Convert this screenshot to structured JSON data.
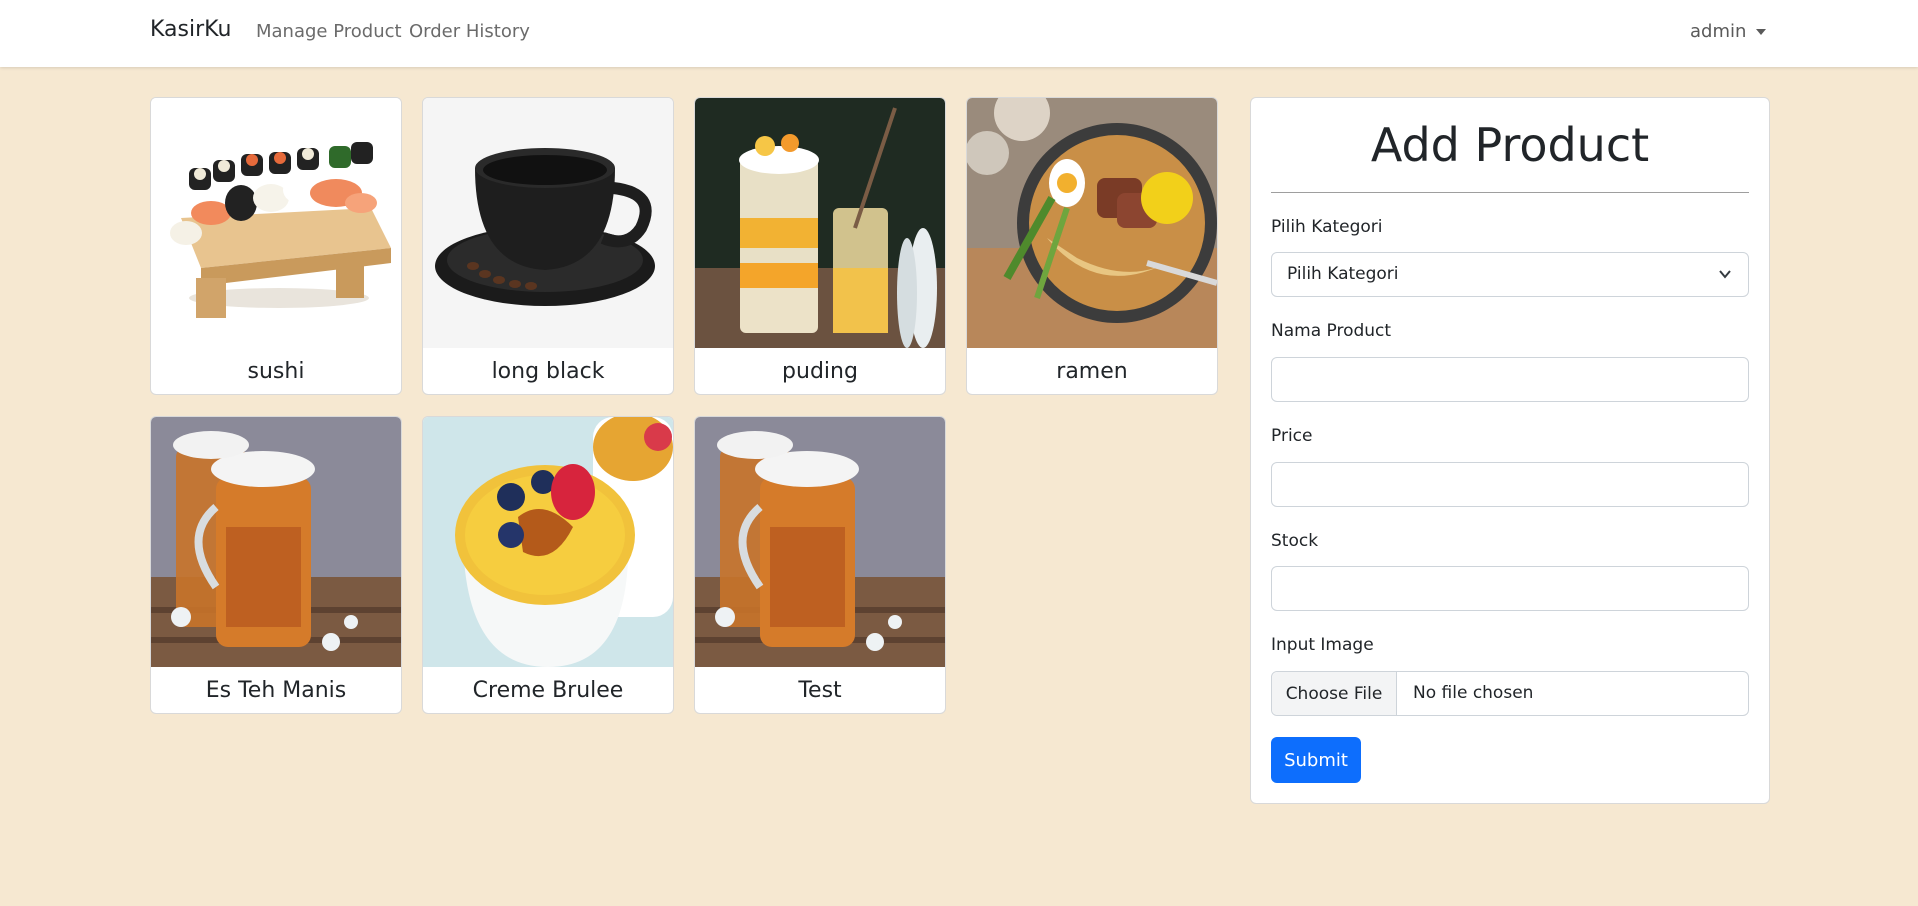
{
  "navbar": {
    "brand": "KasirKu",
    "links": [
      "Manage Product",
      "Order History"
    ],
    "user": "admin"
  },
  "products": [
    {
      "name": "sushi",
      "image": "sushi-platter"
    },
    {
      "name": "long black",
      "image": "coffee-cup"
    },
    {
      "name": "puding",
      "image": "pudding-glass"
    },
    {
      "name": "ramen",
      "image": "ramen-bowl"
    },
    {
      "name": "Es Teh Manis",
      "image": "iced-tea-jar"
    },
    {
      "name": "Creme Brulee",
      "image": "creme-brulee"
    },
    {
      "name": "Test",
      "image": "iced-tea-jar"
    }
  ],
  "form": {
    "title": "Add Product",
    "category_label": "Pilih Kategori",
    "category_selected": "Pilih Kategori",
    "name_label": "Nama Product",
    "price_label": "Price",
    "stock_label": "Stock",
    "image_label": "Input Image",
    "file_button": "Choose File",
    "file_status": "No file chosen",
    "submit": "Submit"
  },
  "colors": {
    "page_bg": "#f6e8d1",
    "primary": "#0d6efd"
  }
}
